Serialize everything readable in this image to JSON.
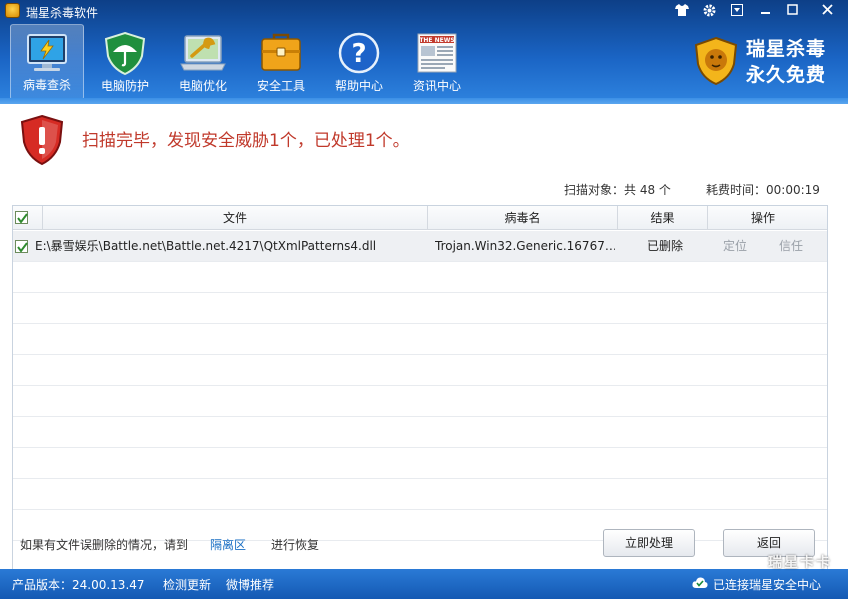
{
  "window": {
    "title": "瑞星杀毒软件",
    "controls": [
      "shirt-icon",
      "gear-icon",
      "menu-icon",
      "minimize-icon",
      "maximize-icon",
      "close-icon"
    ]
  },
  "toolbar": {
    "items": [
      {
        "label": "病毒查杀",
        "icon": "virus-scan-icon",
        "active": true
      },
      {
        "label": "电脑防护",
        "icon": "umbrella-shield-icon",
        "active": false
      },
      {
        "label": "电脑优化",
        "icon": "wrench-laptop-icon",
        "active": false
      },
      {
        "label": "安全工具",
        "icon": "toolbox-icon",
        "active": false
      },
      {
        "label": "帮助中心",
        "icon": "help-icon",
        "active": false
      },
      {
        "label": "资讯中心",
        "icon": "news-icon",
        "active": false
      }
    ],
    "news_icon_text": "THE NEWS"
  },
  "brand": {
    "line1": "瑞星杀毒",
    "line2": "永久免费"
  },
  "result": {
    "message": "扫描完毕，发现安全威胁1个，已处理1个。",
    "scan_objects": "扫描对象：共 48 个",
    "elapsed": "耗费时间：00:00:19"
  },
  "table": {
    "columns": [
      "文件",
      "病毒名",
      "结果",
      "操作"
    ],
    "rows": [
      {
        "checked": true,
        "file": "E:\\暴雪娱乐\\Battle.net\\Battle.net.4217\\QtXmlPatterns4.dll",
        "virus": "Trojan.Win32.Generic.16767…",
        "result": "已删除",
        "action_locate": "定位",
        "action_trust": "信任"
      }
    ],
    "empty_rows": 8
  },
  "footer": {
    "note_prefix": "如果有文件误删除的情况，请到",
    "quarantine_link": "隔离区",
    "note_suffix": "进行恢复",
    "process_button": "立即处理",
    "back_button": "返回"
  },
  "statusbar": {
    "version": "产品版本：24.00.13.47",
    "check_update": "检测更新",
    "weibo": "微博推荐",
    "connected": "已连接瑞星安全中心"
  },
  "watermark": "瑞星卡卡",
  "colors": {
    "header_top": "#0d3f87",
    "header_bottom": "#2f84e0",
    "alert_red": "#c0392b",
    "link_blue": "#1a6fc4",
    "statusbar": "#1f6bc4"
  }
}
